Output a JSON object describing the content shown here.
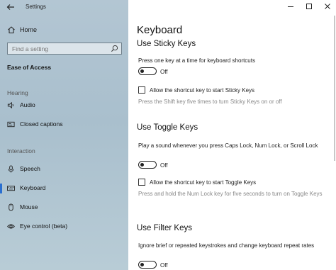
{
  "window": {
    "title": "Settings"
  },
  "sidebar": {
    "home_label": "Home",
    "search_placeholder": "Find a setting",
    "section_title": "Ease of Access",
    "groups": [
      {
        "label": "Hearing",
        "items": [
          {
            "label": "Audio",
            "icon": "audio-icon"
          },
          {
            "label": "Closed captions",
            "icon": "closed-captions-icon"
          }
        ]
      },
      {
        "label": "Interaction",
        "items": [
          {
            "label": "Speech",
            "icon": "microphone-icon"
          },
          {
            "label": "Keyboard",
            "icon": "keyboard-icon",
            "selected": true
          },
          {
            "label": "Mouse",
            "icon": "mouse-icon"
          },
          {
            "label": "Eye control (beta)",
            "icon": "eye-control-icon"
          }
        ]
      }
    ]
  },
  "content": {
    "page_title": "Keyboard",
    "sticky": {
      "heading": "Use Sticky Keys",
      "description": "Press one key at a time for keyboard shortcuts",
      "toggle_state": "Off",
      "checkbox_label": "Allow the shortcut key to start Sticky Keys",
      "hint": "Press the Shift key five times to turn Sticky Keys on or off"
    },
    "toggle_keys": {
      "heading": "Use Toggle Keys",
      "description": "Play a sound whenever you press Caps Lock, Num Lock, or Scroll Lock",
      "toggle_state": "Off",
      "checkbox_label": "Allow the shortcut key to start Toggle Keys",
      "hint": "Press and hold the Num Lock key for five seconds to turn on Toggle Keys"
    },
    "filter": {
      "heading": "Use Filter Keys",
      "description": "Ignore brief or repeated keystrokes and change keyboard repeat rates",
      "toggle_state": "Off"
    }
  },
  "colors": {
    "accent": "#2a6fd0",
    "sidebar_bg": "#adc2cf",
    "hint_text": "#888888"
  }
}
